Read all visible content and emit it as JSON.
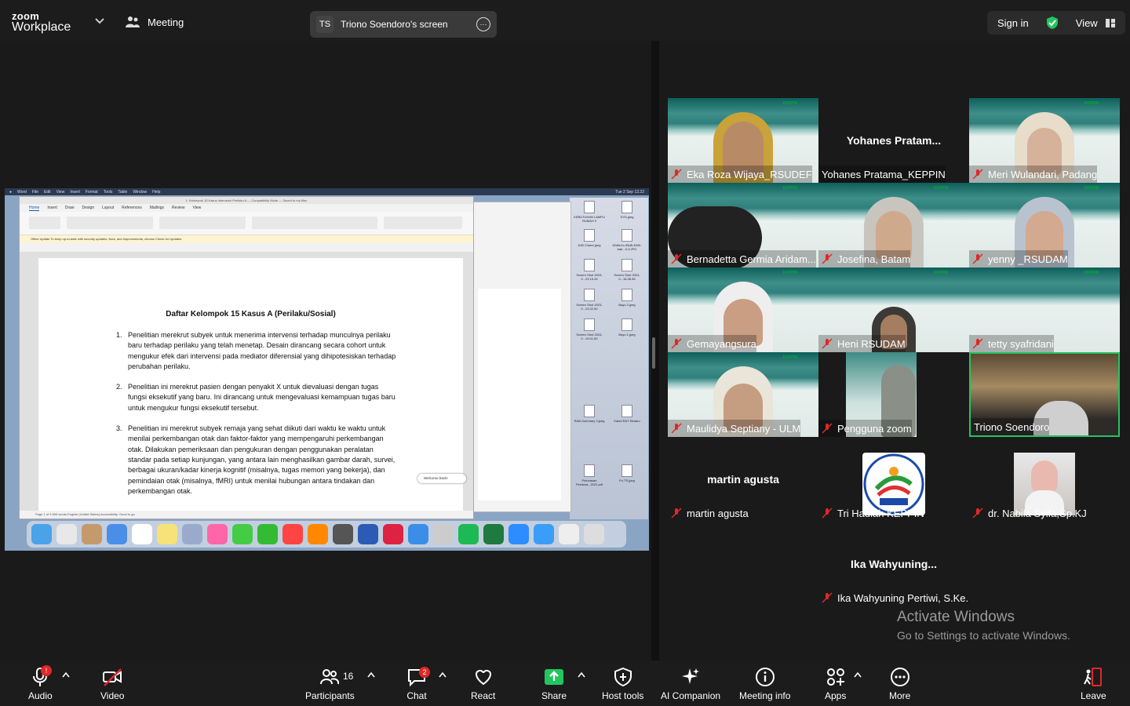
{
  "topbar": {
    "logo_line1": "zoom",
    "logo_line2": "Workplace",
    "meeting_label": "Meeting",
    "share_initials": "TS",
    "share_label": "Triono Soendoro's screen",
    "signin_label": "Sign in",
    "view_label": "View"
  },
  "shared_screen": {
    "mac_menu": [
      "Word",
      "File",
      "Edit",
      "View",
      "Insert",
      "Format",
      "Tools",
      "Table",
      "Window",
      "Help"
    ],
    "mac_clock": "Tue 2 Sep 13.22",
    "word_title": "1. Kelompok 15 Kasus Intervensi Perilaku A — Compatibility Mode — Saved to my Mac",
    "word_tabs": [
      "Home",
      "Insert",
      "Draw",
      "Design",
      "Layout",
      "References",
      "Mailings",
      "Review",
      "View"
    ],
    "update_banner": "Office Update  To keep up-to-date with security updates, fixes, and improvements, choose Check for Updates.",
    "doc_title": "Daftar Kelompok 15 Kasus A (Perilaku/Sosial)",
    "doc_items": [
      {
        "num": "1.",
        "text": "Penelitian merekrut subyek untuk menerima intervensi terhadap munculnya perilaku baru terhadap perilaku yang telah menetap. Desain dirancang secara cohort untuk mengukur efek dari intervensi pada mediator diferensial yang dihipotesiskan terhadap perubahan perilaku."
      },
      {
        "num": "2.",
        "text": "Penelitian ini merekrut pasien dengan penyakit X untuk dievaluasi dengan tugas fungsi eksekutif yang baru. Ini dirancang untuk mengevaluasi kemampuan tugas baru untuk mengukur fungsi eksekutif tersebut."
      },
      {
        "num": "3.",
        "text": "Penelitian ini merekrut subyek remaja yang sehat diikuti dari waktu ke waktu untuk menilai perkembangan otak dan faktor-faktor yang mempengaruhi perkembangan otak. Dilakukan pemeriksaan dan pengukuran dengan penggunakan peralatan standar pada setiap kunjungan, yang antara lain menghasilkan gambar darah, survei, berbagai ukuran/kadar kinerja kognitif (misalnya, tugas memori yang bekerja), dan pemindaian otak (misalnya, fMRI) untuk menilai hubungan antara tindakan dan perkembangan otak."
      }
    ],
    "status_bar": "Page 1 of 3    695 words    English (United States)    Accessibility: Good to go",
    "welcome_toast": "Welcome back!",
    "desktop_files": [
      "KEBUTUHAN LAMPU RUMAH II",
      "SYD.jpeg",
      "AJB Cinere.jpeg",
      "62d6c1c-95d8-4540-bab...9-3.JPG",
      "Screen Shot 2023-0...23.15.26",
      "Screen Shot 2024-0...16.36.55",
      "Screen Shot 2023-0...23.02.50",
      "Bayu 2.jpeg",
      "Screen Shot 2023-0...19.01.50",
      "Bayu 1.jpeg",
      "RAB-Summary 3.jpeg",
      "Kabel E8/7 Bintaro",
      "Pelunasan Perdana...2022.pdf",
      "Fn-TS.jpeg"
    ]
  },
  "participants": [
    {
      "name": "Eka Roza Wijaya_RSUDEF",
      "muted": true,
      "video": true
    },
    {
      "name": "Yohanes Pratama_KEPPIN",
      "muted": false,
      "video": false,
      "big_name": "Yohanes  Pratam..."
    },
    {
      "name": "Meri Wulandari, Padang",
      "muted": true,
      "video": true
    },
    {
      "name": "Bernadetta Germia Aridam...",
      "muted": true,
      "video": true
    },
    {
      "name": "Josefina, Batam",
      "muted": true,
      "video": true
    },
    {
      "name": "yenny _RSUDAM",
      "muted": true,
      "video": true
    },
    {
      "name": "Gemayangsura",
      "muted": true,
      "video": true
    },
    {
      "name": "Heni RSUDAM",
      "muted": true,
      "video": true
    },
    {
      "name": "tetty syafridani",
      "muted": true,
      "video": true
    },
    {
      "name": "Maulidya Septiany - ULM",
      "muted": true,
      "video": true
    },
    {
      "name": "Pengguna zoom",
      "muted": true,
      "video": true
    },
    {
      "name": "Triono Soendoro",
      "muted": false,
      "video": true,
      "active_speaker": true
    },
    {
      "name": "martin agusta",
      "muted": true,
      "video": false,
      "big_name": "martin agusta"
    },
    {
      "name": "Tri Hadiah KEPPIN",
      "muted": true,
      "video": false,
      "avatar": "KEPPIN"
    },
    {
      "name": "dr. Nabila Syifa,Sp.KJ",
      "muted": true,
      "video": false
    },
    {
      "name": "Ika Wahyuning Pertiwi, S.Ke...",
      "muted": true,
      "video": false,
      "big_name": "Ika  Wahyuning..."
    }
  ],
  "watermark": {
    "line1": "Activate Windows",
    "line2": "Go to Settings to activate Windows."
  },
  "toolbar": {
    "audio": "Audio",
    "video": "Video",
    "participants": "Participants",
    "participants_count": "16",
    "chat": "Chat",
    "chat_badge": "2",
    "audio_badge": "!",
    "react": "React",
    "share": "Share",
    "host_tools": "Host tools",
    "ai_companion": "AI Companion",
    "meeting_info": "Meeting info",
    "apps": "Apps",
    "more": "More",
    "leave": "Leave"
  },
  "colors": {
    "accent_green": "#22c55e",
    "share_green": "#22c55e",
    "muted_red": "#e02828",
    "bg": "#1a1a1a"
  }
}
